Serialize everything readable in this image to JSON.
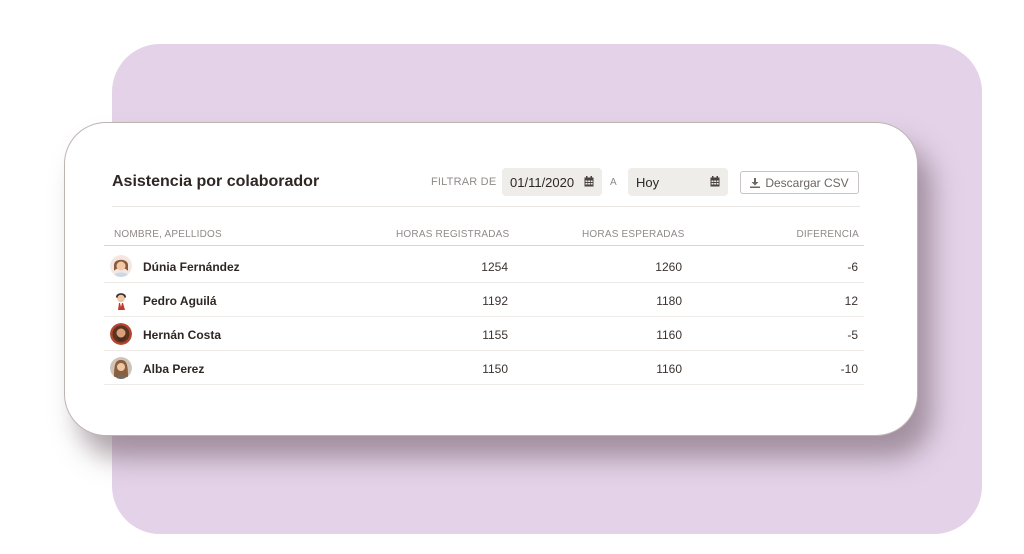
{
  "header": {
    "title": "Asistencia por colaborador",
    "filter_label": "FILTRAR DE",
    "date_from": "01/11/2020",
    "a_label": "A",
    "date_to": "Hoy",
    "csv_button": "Descargar CSV"
  },
  "table": {
    "columns": [
      "NOMBRE, APELLIDOS",
      "HORAS REGISTRADAS",
      "HORAS ESPERADAS",
      "DIFERENCIA"
    ],
    "rows": [
      {
        "name": "Dúnia Fernández",
        "registradas": "1254",
        "esperadas": "1260",
        "diferencia": "-6"
      },
      {
        "name": "Pedro Aguilá",
        "registradas": "1192",
        "esperadas": "1180",
        "diferencia": "12"
      },
      {
        "name": "Hernán Costa",
        "registradas": "1155",
        "esperadas": "1160",
        "diferencia": "-5"
      },
      {
        "name": "Alba Perez",
        "registradas": "1150",
        "esperadas": "1160",
        "diferencia": "-10"
      }
    ]
  },
  "icons": {
    "calendar": "calendar-icon",
    "download": "download-icon"
  },
  "colors": {
    "background_panel": "#e3d2e8",
    "date_box": "#efede9"
  }
}
